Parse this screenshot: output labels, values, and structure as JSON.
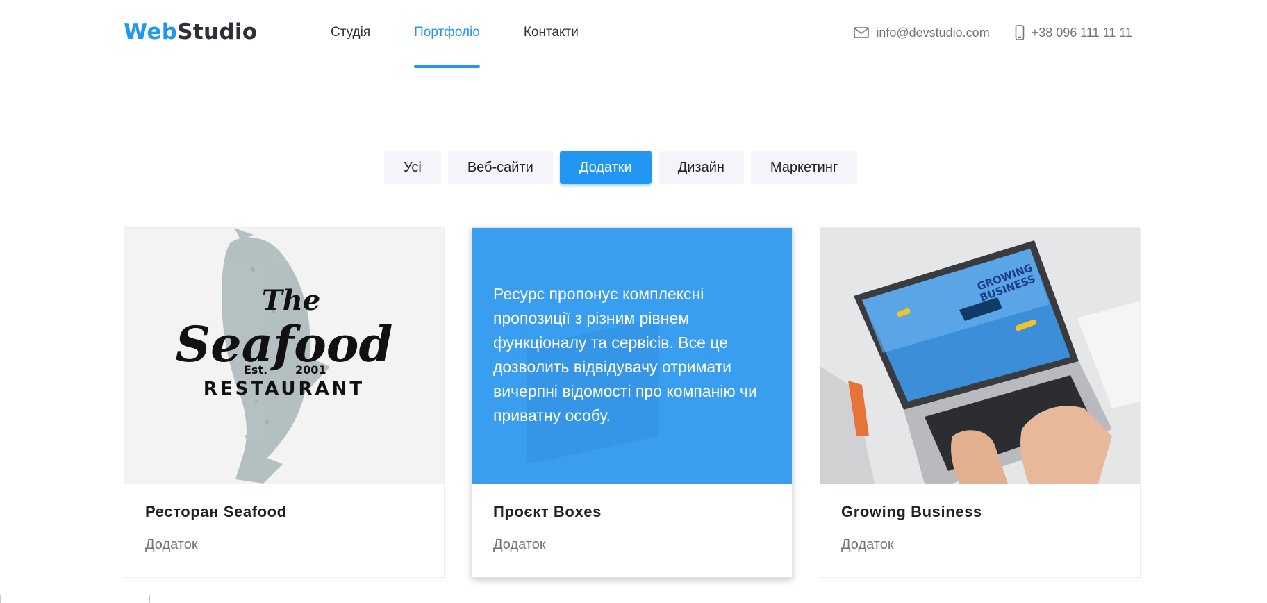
{
  "brand": {
    "part1": "Web",
    "part2": "Studio",
    "accent_color": "#2196f3"
  },
  "nav": {
    "items": [
      {
        "label": "Студія",
        "active": false
      },
      {
        "label": "Портфоліо",
        "active": true
      },
      {
        "label": "Контакти",
        "active": false
      }
    ]
  },
  "contacts": {
    "email": "info@devstudio.com",
    "phone": "+38 096 111 11 11"
  },
  "filters": {
    "items": [
      {
        "label": "Усі",
        "active": false
      },
      {
        "label": "Веб-сайти",
        "active": false
      },
      {
        "label": "Додатки",
        "active": true
      },
      {
        "label": "Дизайн",
        "active": false
      },
      {
        "label": "Маркетинг",
        "active": false
      }
    ]
  },
  "cards": [
    {
      "title": "Ресторан Seafood",
      "category": "Додаток",
      "logo": {
        "the": "The",
        "name": "Seafood",
        "est": "Est.",
        "year": "2001",
        "sub": "RESTAURANT"
      }
    },
    {
      "title": "Проєкт Boxes",
      "category": "Додаток",
      "overlay_text": "Ресурс пропонує комплексні пропозиції з різним рівнем функціоналу та сервісів. Все це дозволить відвідувачу отримати вичерпні відомості про компанію чи приватну особу."
    },
    {
      "title": "Growing Business",
      "category": "Додаток",
      "screen_text": {
        "line1": "GROWING",
        "line2": "BUSINESS"
      }
    }
  ]
}
